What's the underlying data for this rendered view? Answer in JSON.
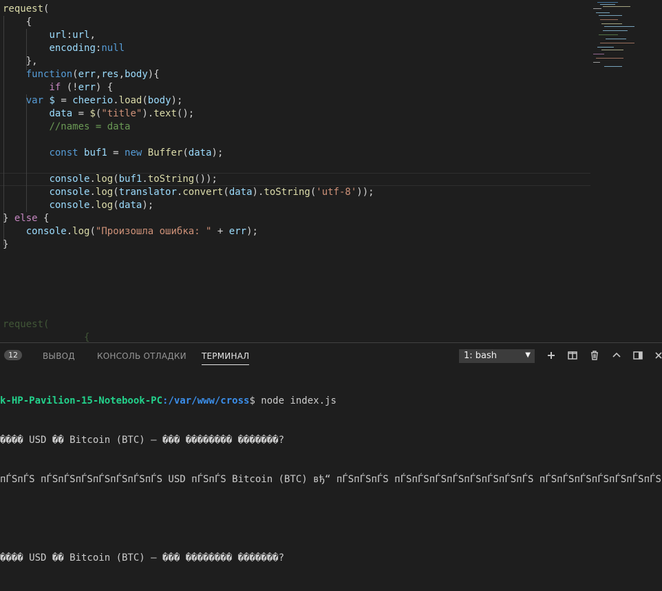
{
  "editor": {
    "code_lines": [
      {
        "indent": "",
        "tokens": [
          {
            "c": "f",
            "t": "request"
          },
          {
            "c": "p",
            "t": "("
          }
        ]
      },
      {
        "indent": "    ",
        "tokens": [
          {
            "c": "p",
            "t": "{"
          }
        ]
      },
      {
        "indent": "        ",
        "tokens": [
          {
            "c": "v",
            "t": "url"
          },
          {
            "c": "p",
            "t": ":"
          },
          {
            "c": "v",
            "t": "url"
          },
          {
            "c": "p",
            "t": ","
          }
        ]
      },
      {
        "indent": "        ",
        "tokens": [
          {
            "c": "v",
            "t": "encoding"
          },
          {
            "c": "p",
            "t": ":"
          },
          {
            "c": "k",
            "t": "null"
          }
        ]
      },
      {
        "indent": "    ",
        "tokens": [
          {
            "c": "p",
            "t": "},"
          }
        ]
      },
      {
        "indent": "    ",
        "tokens": [
          {
            "c": "k",
            "t": "function"
          },
          {
            "c": "p",
            "t": "("
          },
          {
            "c": "v",
            "t": "err"
          },
          {
            "c": "p",
            "t": ","
          },
          {
            "c": "v",
            "t": "res"
          },
          {
            "c": "p",
            "t": ","
          },
          {
            "c": "v",
            "t": "body"
          },
          {
            "c": "p",
            "t": "){"
          }
        ]
      },
      {
        "indent": "        ",
        "tokens": [
          {
            "c": "kc",
            "t": "if"
          },
          {
            "c": "p",
            "t": " (!"
          },
          {
            "c": "v",
            "t": "err"
          },
          {
            "c": "p",
            "t": ") {"
          }
        ]
      },
      {
        "indent": "    ",
        "tokens": [
          {
            "c": "k",
            "t": "var"
          },
          {
            "c": "p",
            "t": " "
          },
          {
            "c": "v",
            "t": "$"
          },
          {
            "c": "p",
            "t": " = "
          },
          {
            "c": "v",
            "t": "cheerio"
          },
          {
            "c": "p",
            "t": "."
          },
          {
            "c": "f",
            "t": "load"
          },
          {
            "c": "p",
            "t": "("
          },
          {
            "c": "v",
            "t": "body"
          },
          {
            "c": "p",
            "t": ");"
          }
        ]
      },
      {
        "indent": "        ",
        "tokens": [
          {
            "c": "v",
            "t": "data"
          },
          {
            "c": "p",
            "t": " = "
          },
          {
            "c": "f",
            "t": "$"
          },
          {
            "c": "p",
            "t": "("
          },
          {
            "c": "s",
            "t": "\"title\""
          },
          {
            "c": "p",
            "t": ")."
          },
          {
            "c": "f",
            "t": "text"
          },
          {
            "c": "p",
            "t": "();"
          }
        ]
      },
      {
        "indent": "        ",
        "tokens": [
          {
            "c": "c",
            "t": "//names = data"
          }
        ]
      },
      {
        "indent": "",
        "tokens": []
      },
      {
        "indent": "        ",
        "tokens": [
          {
            "c": "k",
            "t": "const"
          },
          {
            "c": "p",
            "t": " "
          },
          {
            "c": "v",
            "t": "buf1"
          },
          {
            "c": "p",
            "t": " = "
          },
          {
            "c": "k",
            "t": "new"
          },
          {
            "c": "p",
            "t": " "
          },
          {
            "c": "f",
            "t": "Buffer"
          },
          {
            "c": "p",
            "t": "("
          },
          {
            "c": "v",
            "t": "data"
          },
          {
            "c": "p",
            "t": ");"
          }
        ]
      },
      {
        "indent": "",
        "tokens": []
      },
      {
        "indent": "        ",
        "tokens": [
          {
            "c": "v",
            "t": "console"
          },
          {
            "c": "p",
            "t": "."
          },
          {
            "c": "f",
            "t": "log"
          },
          {
            "c": "p",
            "t": "("
          },
          {
            "c": "v",
            "t": "buf1"
          },
          {
            "c": "p",
            "t": "."
          },
          {
            "c": "f",
            "t": "toString"
          },
          {
            "c": "p",
            "t": "());"
          }
        ]
      },
      {
        "indent": "        ",
        "tokens": [
          {
            "c": "v",
            "t": "console"
          },
          {
            "c": "p",
            "t": "."
          },
          {
            "c": "f",
            "t": "log"
          },
          {
            "c": "p",
            "t": "("
          },
          {
            "c": "v",
            "t": "translator"
          },
          {
            "c": "p",
            "t": "."
          },
          {
            "c": "f",
            "t": "convert"
          },
          {
            "c": "p",
            "t": "("
          },
          {
            "c": "v",
            "t": "data"
          },
          {
            "c": "p",
            "t": ")."
          },
          {
            "c": "f",
            "t": "toString"
          },
          {
            "c": "p",
            "t": "("
          },
          {
            "c": "s",
            "t": "'utf-8'"
          },
          {
            "c": "p",
            "t": "));"
          }
        ]
      },
      {
        "indent": "        ",
        "tokens": [
          {
            "c": "v",
            "t": "console"
          },
          {
            "c": "p",
            "t": "."
          },
          {
            "c": "f",
            "t": "log"
          },
          {
            "c": "p",
            "t": "("
          },
          {
            "c": "v",
            "t": "data"
          },
          {
            "c": "p",
            "t": ");"
          }
        ]
      },
      {
        "indent": "",
        "tokens": [
          {
            "c": "p",
            "t": "} "
          },
          {
            "c": "kc",
            "t": "else"
          },
          {
            "c": "p",
            "t": " {"
          }
        ]
      },
      {
        "indent": "    ",
        "tokens": [
          {
            "c": "v",
            "t": "console"
          },
          {
            "c": "p",
            "t": "."
          },
          {
            "c": "f",
            "t": "log"
          },
          {
            "c": "p",
            "t": "("
          },
          {
            "c": "s",
            "t": "\"Произошла ошибка: \""
          },
          {
            "c": "p",
            "t": " + "
          },
          {
            "c": "v",
            "t": "err"
          },
          {
            "c": "p",
            "t": ");"
          }
        ]
      },
      {
        "indent": "",
        "tokens": [
          {
            "c": "p",
            "t": "}"
          }
        ]
      }
    ],
    "ghost_lines": [
      {
        "indent": "",
        "tokens": [
          {
            "c": "c",
            "t": "request("
          }
        ]
      },
      {
        "indent": "              ",
        "tokens": [
          {
            "c": "c",
            "t": "{"
          }
        ]
      }
    ]
  },
  "panel": {
    "problems_count": "12",
    "tabs": [
      {
        "label": "ВЫВОД",
        "active": false
      },
      {
        "label": "КОНСОЛЬ ОТЛАДКИ",
        "active": false
      },
      {
        "label": "ТЕРМИНАЛ",
        "active": true
      }
    ],
    "terminal_select": "1: bash",
    "icons": [
      "plus-icon",
      "split-icon",
      "trash-icon",
      "chevron-up-icon",
      "maximize-icon",
      "close-icon"
    ]
  },
  "terminal": {
    "prompt_host": "k-HP-Pavilion-15-Notebook-PC",
    "prompt_path": ":/var/www/cross",
    "prompt_cmd": "$ node index.js",
    "lines": [
      "���� USD �� Bitcoin (BTC) — ��� �������� �������?",
      "пЃЅпЃЅ пЃЅпЃЅпЃЅпЃЅпЃЅпЃЅпЃЅ USD пЃЅпЃЅ Bitcoin (BTC) вђ“ пЃЅпЃЅпЃЅ пЃЅпЃЅпЃЅпЃЅпЃЅпЃЅпЃЅпЃЅ пЃЅпЃЅпЃЅпЃЅпЃЅпЃЅпЃЅпЃЅ",
      "",
      "���� USD �� Bitcoin (BTC) — ��� �������� �������?"
    ]
  },
  "colors": {
    "background": "#1e1e1e",
    "keyword": "#569cd6",
    "variable": "#9cdcfe",
    "function": "#dcdcaa",
    "string": "#ce9178",
    "comment": "#6a9955",
    "prompt_host": "#23d18b",
    "prompt_path": "#3b8eea"
  }
}
